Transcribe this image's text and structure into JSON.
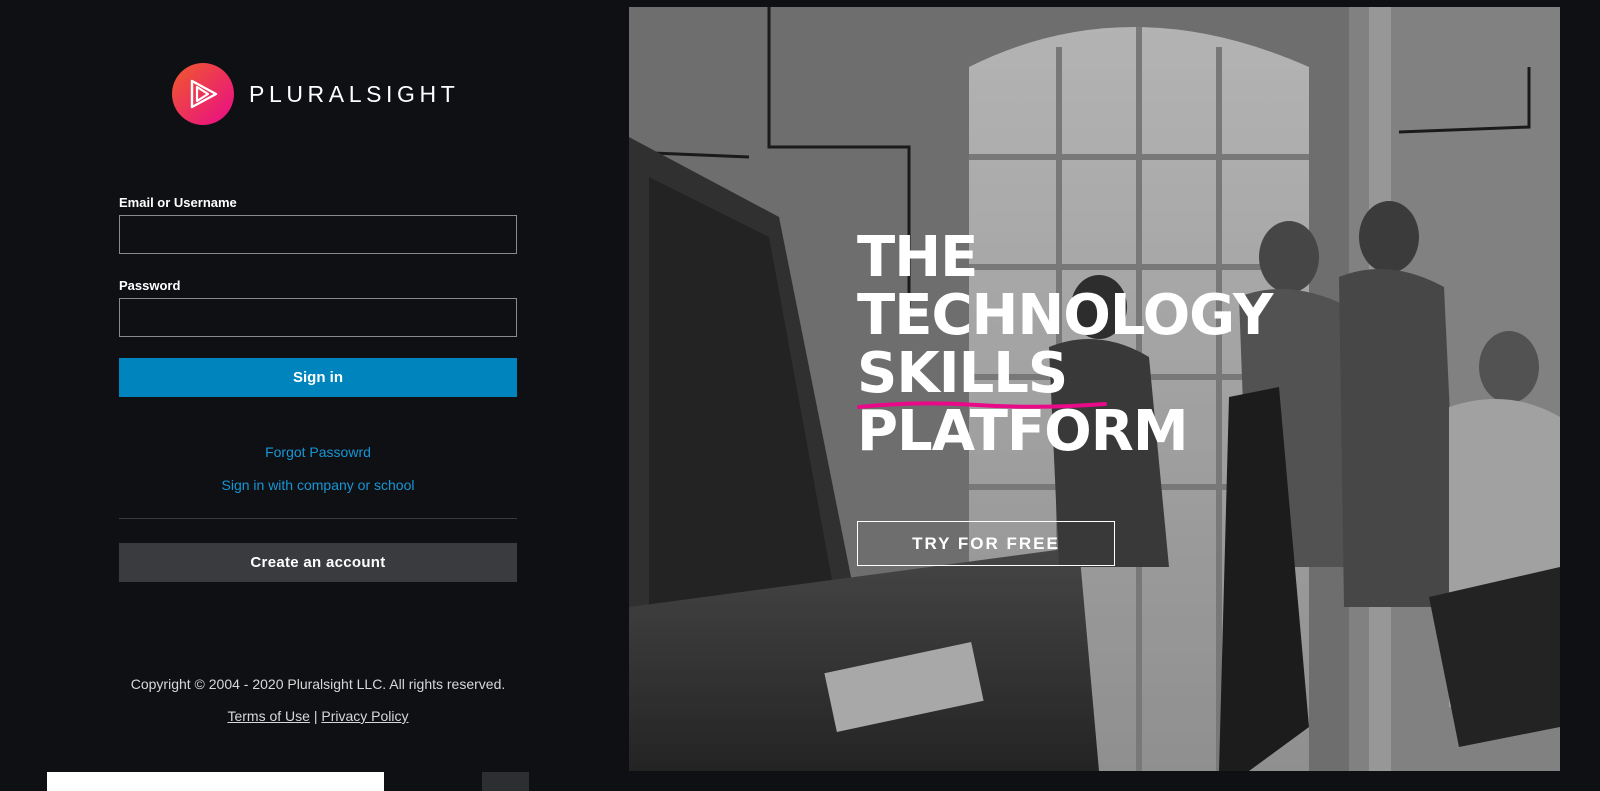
{
  "brand": {
    "name": "PLURALSIGHT"
  },
  "form": {
    "email_label": "Email or Username",
    "email_value": "",
    "password_label": "Password",
    "password_value": "",
    "signin_label": "Sign in",
    "forgot_label": "Forgot Passowrd",
    "company_label": "Sign in with company or school",
    "create_label": "Create an account"
  },
  "footer": {
    "copyright": "Copyright © 2004 - 2020 Pluralsight LLC. All rights reserved.",
    "terms": "Terms of Use",
    "separator": "|",
    "privacy": "Privacy Policy"
  },
  "hero": {
    "headline": [
      "THE",
      "TECHNOLOGY",
      "SKILLS",
      "PLATFORM"
    ],
    "cta": "TRY FOR FREE"
  },
  "colors": {
    "background": "#0f1014",
    "primary_button": "#0084bd",
    "secondary_button": "#3a3b3f",
    "link": "#1795d4",
    "brand_gradient_start": "#f15b2a",
    "brand_gradient_end": "#e80a89"
  },
  "icons": {
    "logo": "pluralsight-play-icon"
  }
}
